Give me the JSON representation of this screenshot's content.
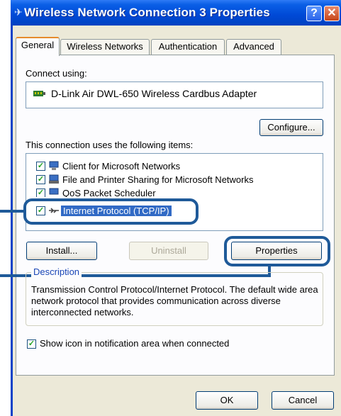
{
  "window": {
    "title": "Wireless Network Connection 3 Properties",
    "help_glyph": "?",
    "close_glyph": "✕"
  },
  "tabs": [
    "General",
    "Wireless Networks",
    "Authentication",
    "Advanced"
  ],
  "connect_using": {
    "label": "Connect using:",
    "adapter": "D-Link Air DWL-650 Wireless Cardbus Adapter",
    "configure_button": "Configure..."
  },
  "items_section": {
    "label": "This connection uses the following items:",
    "items": [
      {
        "label": "Client for Microsoft Networks",
        "checked": true,
        "icon": "network-client-icon"
      },
      {
        "label": "File and Printer Sharing for Microsoft Networks",
        "checked": true,
        "icon": "file-printer-sharing-icon"
      },
      {
        "label": "QoS Packet Scheduler",
        "checked": true,
        "icon": "qos-icon"
      },
      {
        "label": "Internet Protocol (TCP/IP)",
        "checked": true,
        "icon": "protocol-icon",
        "selected": true
      }
    ]
  },
  "buttons": {
    "install": "Install...",
    "uninstall": "Uninstall",
    "properties": "Properties",
    "ok": "OK",
    "cancel": "Cancel"
  },
  "description": {
    "label": "Description",
    "text": "Transmission Control Protocol/Internet Protocol. The default wide area network protocol that provides communication across diverse interconnected networks."
  },
  "notification": {
    "label": "Show icon in notification area when connected",
    "checked": true
  },
  "colors": {
    "titlebar": "#0049d6",
    "highlight": "#1f5a99",
    "selection": "#316ac5"
  }
}
